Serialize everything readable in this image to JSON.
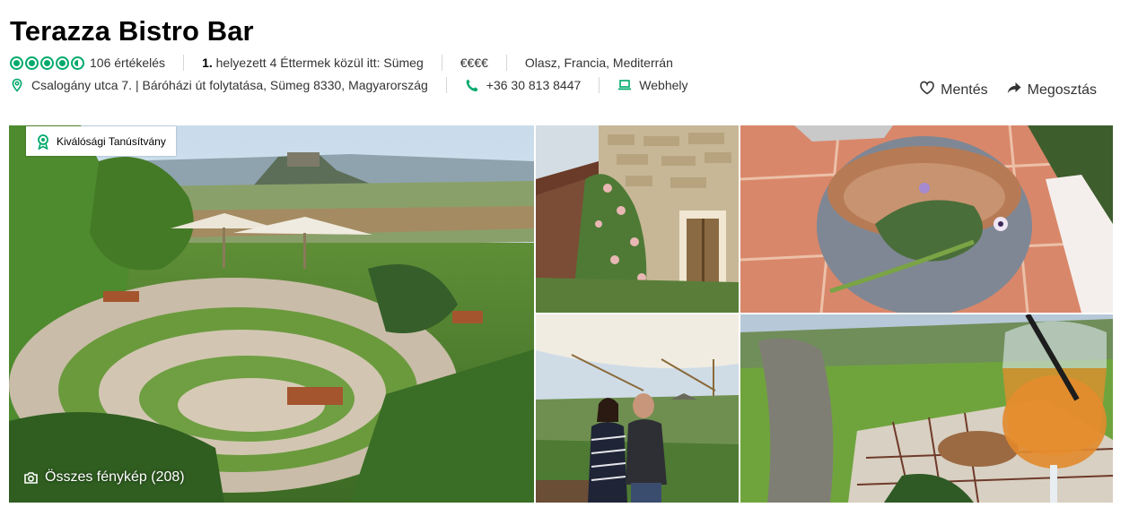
{
  "header": {
    "title": "Terazza Bistro Bar",
    "rating_value": 4.5,
    "reviews": "106 értékelés",
    "rank_num": "1.",
    "rank_text": " helyezett 4 Éttermek közül itt: Sümeg",
    "price": "€€€€",
    "cuisines": "Olasz, Francia, Mediterrán",
    "address": "Csalogány utca 7. | Báróházi út folytatása, Sümeg 8330, Magyarország",
    "phone": "+36 30 813 8447",
    "website": "Webhely"
  },
  "actions": {
    "save": "Mentés",
    "share": "Megosztás"
  },
  "gallery": {
    "badge": "Kiválósági Tanúsítvány",
    "all_photos": "Összes fénykép (208)"
  },
  "colors": {
    "accent": "#00aa6c",
    "text": "#333333"
  }
}
